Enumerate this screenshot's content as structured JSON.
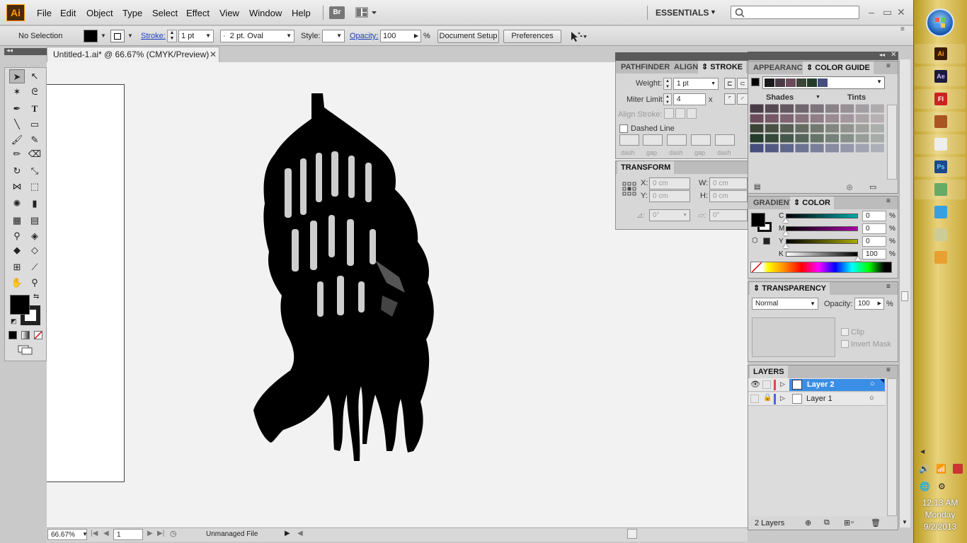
{
  "app": {
    "logo": "Ai"
  },
  "menu": [
    "File",
    "Edit",
    "Object",
    "Type",
    "Select",
    "Effect",
    "View",
    "Window",
    "Help"
  ],
  "bridge_button": "Br",
  "workspace": "ESSENTIALS",
  "control": {
    "selection": "No Selection",
    "stroke_label": "Stroke:",
    "stroke_value": "1 pt",
    "brush_prefix": "·",
    "brush": "2 pt. Oval",
    "style_label": "Style:",
    "opacity_label": "Opacity:",
    "opacity_value": "100",
    "opacity_unit": "%",
    "document_setup": "Document Setup",
    "preferences": "Preferences"
  },
  "document": {
    "tab_title": "Untitled-1.ai* @ 66.67% (CMYK/Preview)",
    "zoom": "66.67%",
    "page": "1",
    "status": "Unmanaged File"
  },
  "stroke_panel": {
    "tabs": [
      "PATHFINDER",
      "ALIGN",
      "STROKE"
    ],
    "weight_label": "Weight:",
    "weight_value": "1 pt",
    "miter_label": "Miter Limit:",
    "miter_value": "4",
    "miter_unit": "x",
    "align_label": "Align Stroke:",
    "dashed_label": "Dashed Line",
    "dash_labels": [
      "dash",
      "gap",
      "dash",
      "gap",
      "dash"
    ]
  },
  "transform_panel": {
    "title": "TRANSFORM",
    "x_label": "X:",
    "x_value": "0 cm",
    "y_label": "Y:",
    "y_value": "0 cm",
    "w_label": "W:",
    "w_value": "0 cm",
    "h_label": "H:",
    "h_value": "0 cm",
    "rotate_value": "0°",
    "shear_value": "0°"
  },
  "color_guide": {
    "tabs": [
      "APPEARANCE",
      "COLOR GUIDE"
    ],
    "shades_label": "Shades",
    "tints_label": "Tints",
    "harmony": [
      "#1a1a1a",
      "#4a3c46",
      "#6b4b5a",
      "#3b4436",
      "#243b2a",
      "#454e7c"
    ]
  },
  "color_panel": {
    "tabs": [
      "GRADIENT",
      "COLOR"
    ],
    "channels": [
      {
        "label": "C",
        "value": "0"
      },
      {
        "label": "M",
        "value": "0"
      },
      {
        "label": "Y",
        "value": "0"
      },
      {
        "label": "K",
        "value": "100"
      }
    ],
    "unit": "%"
  },
  "transparency_panel": {
    "title": "TRANSPARENCY",
    "blend_mode": "Normal",
    "opacity_label": "Opacity:",
    "opacity_value": "100",
    "unit": "%",
    "clip_label": "Clip",
    "invert_label": "Invert Mask"
  },
  "layers_panel": {
    "title": "LAYERS",
    "layers": [
      {
        "name": "Layer 2",
        "selected": true
      },
      {
        "name": "Layer 1",
        "selected": false
      }
    ],
    "count": "2 Layers"
  },
  "taskbar": {
    "apps": [
      "Ai",
      "Ae",
      "Fl",
      "",
      "",
      "Ps",
      "",
      "",
      "",
      ""
    ],
    "time": "12:13 AM",
    "day": "Monday",
    "date": "9/2/2013"
  }
}
